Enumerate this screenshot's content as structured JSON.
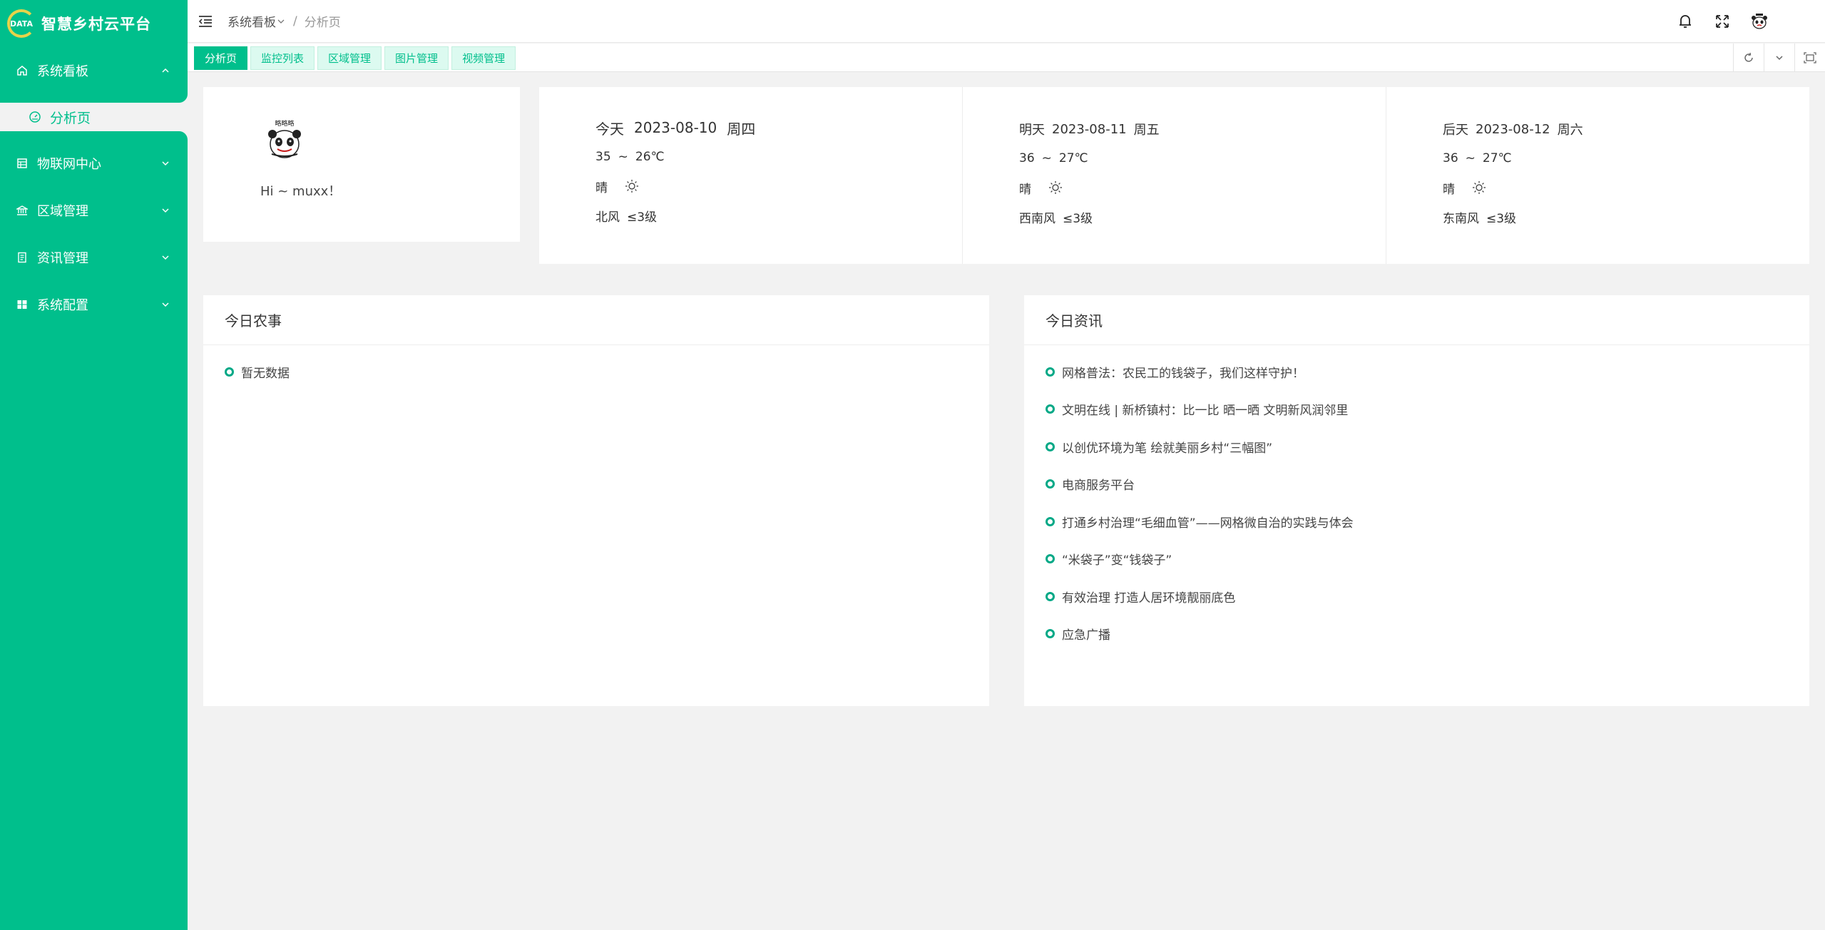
{
  "app": {
    "title": "智慧乡村云平台",
    "logo_text": "DATA"
  },
  "sidebar": {
    "items": [
      {
        "label": "系统看板",
        "icon": "home-icon",
        "expanded": true,
        "children": [
          {
            "label": "分析页",
            "icon": "dashboard-icon",
            "active": true
          }
        ]
      },
      {
        "label": "物联网中心",
        "icon": "iot-icon",
        "expanded": false
      },
      {
        "label": "区域管理",
        "icon": "bank-icon",
        "expanded": false
      },
      {
        "label": "资讯管理",
        "icon": "document-icon",
        "expanded": false
      },
      {
        "label": "系统配置",
        "icon": "windows-icon",
        "expanded": false
      }
    ]
  },
  "header": {
    "breadcrumb": {
      "parent": "系统看板",
      "separator": "/",
      "current": "分析页"
    },
    "icons": [
      "bell-icon",
      "fullscreen-icon",
      "user-avatar"
    ]
  },
  "tabs": [
    {
      "label": "分析页",
      "active": true
    },
    {
      "label": "监控列表",
      "active": false
    },
    {
      "label": "区域管理",
      "active": false
    },
    {
      "label": "图片管理",
      "active": false
    },
    {
      "label": "视频管理",
      "active": false
    }
  ],
  "tab_tools": [
    "refresh-icon",
    "chevron-down-icon",
    "maximize-icon"
  ],
  "user": {
    "greeting": "Hi ~ muxx！",
    "avatar_caption": "略略略"
  },
  "weather": [
    {
      "label": "今天",
      "date": "2023-08-10",
      "weekday": "周四",
      "high": "35",
      "tilde": "~",
      "low": "26℃",
      "condition": "晴",
      "wind_dir": "北风",
      "wind_level": "≤3级"
    },
    {
      "label": "明天",
      "date": "2023-08-11",
      "weekday": "周五",
      "high": "36",
      "tilde": "~",
      "low": "27℃",
      "condition": "晴",
      "wind_dir": "西南风",
      "wind_level": "≤3级"
    },
    {
      "label": "后天",
      "date": "2023-08-12",
      "weekday": "周六",
      "high": "36",
      "tilde": "~",
      "low": "27℃",
      "condition": "晴",
      "wind_dir": "东南风",
      "wind_level": "≤3级"
    }
  ],
  "farm": {
    "title": "今日农事",
    "items": [
      "暂无数据"
    ]
  },
  "news": {
    "title": "今日资讯",
    "items": [
      "网格普法：农民工的钱袋子，我们这样守护！",
      "文明在线 | 新桥镇村：比一比 晒一晒 文明新风润邻里",
      "以创优环境为笔 绘就美丽乡村“三幅图”",
      "电商服务平台",
      "打通乡村治理“毛细血管”——网格微自治的实践与体会",
      "“米袋子”变“钱袋子”",
      "有效治理 打造人居环境靓丽底色",
      "应急广播"
    ]
  },
  "colors": {
    "brand": "#00bf8c",
    "tab_bg": "#dcfaf0",
    "page_bg": "#f2f2f2"
  }
}
